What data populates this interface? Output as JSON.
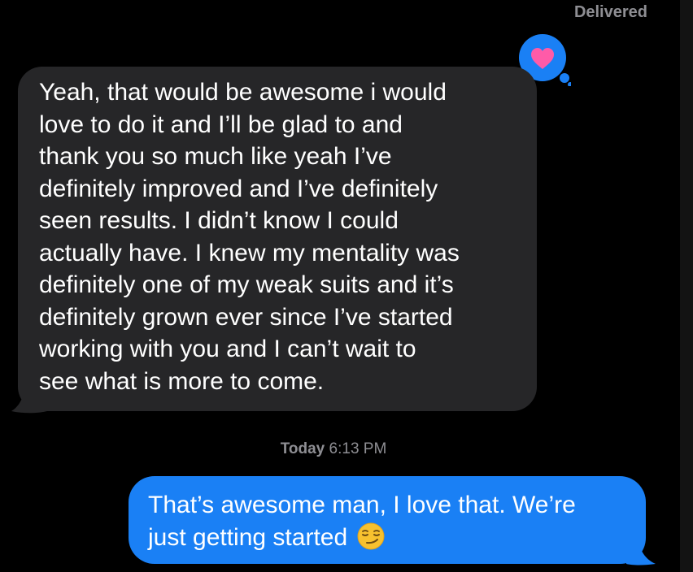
{
  "header": {
    "status": "Delivered"
  },
  "reaction": {
    "icon": "heart-icon",
    "bubble_color": "#1a80f5",
    "heart_color": "#ff5ba8"
  },
  "messages": [
    {
      "direction": "incoming",
      "text": "Yeah, that would be awesome i would\nlove to do it and I’ll be glad to and\nthank you so much like yeah I’ve\ndefinitely improved and I’ve definitely\nseen results. I didn’t  know I could\nactually have. I knew my mentality was\ndefinitely one of my weak suits and it’s\ndefinitely grown ever since I’ve started\nworking with you and I can’t wait to\nsee what is more to come.",
      "bubble_color": "#262628"
    },
    {
      "direction": "outgoing",
      "text": "That’s awesome man, I love that. We’re\njust getting started",
      "emoji": "smirking-face-emoji",
      "bubble_color": "#1a80f5"
    }
  ],
  "timestamp": {
    "day": "Today",
    "time": "6:13 PM"
  }
}
